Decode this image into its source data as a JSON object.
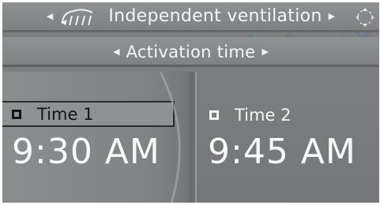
{
  "header": {
    "title": "Independent ventilation",
    "vent_icon": "ventilation-fan-icon",
    "controller_icon": "controller-direction-icon"
  },
  "submenu": {
    "title": "Activation time"
  },
  "timers": [
    {
      "label": "Time 1",
      "value": "9:30 AM",
      "selected": true,
      "checked": false
    },
    {
      "label": "Time 2",
      "value": "9:45 AM",
      "selected": false,
      "checked": false
    }
  ],
  "colors": {
    "background": "#7b7f80",
    "text": "#f4f5f5",
    "selected_row": "#8e9293",
    "selected_text": "#141516"
  }
}
